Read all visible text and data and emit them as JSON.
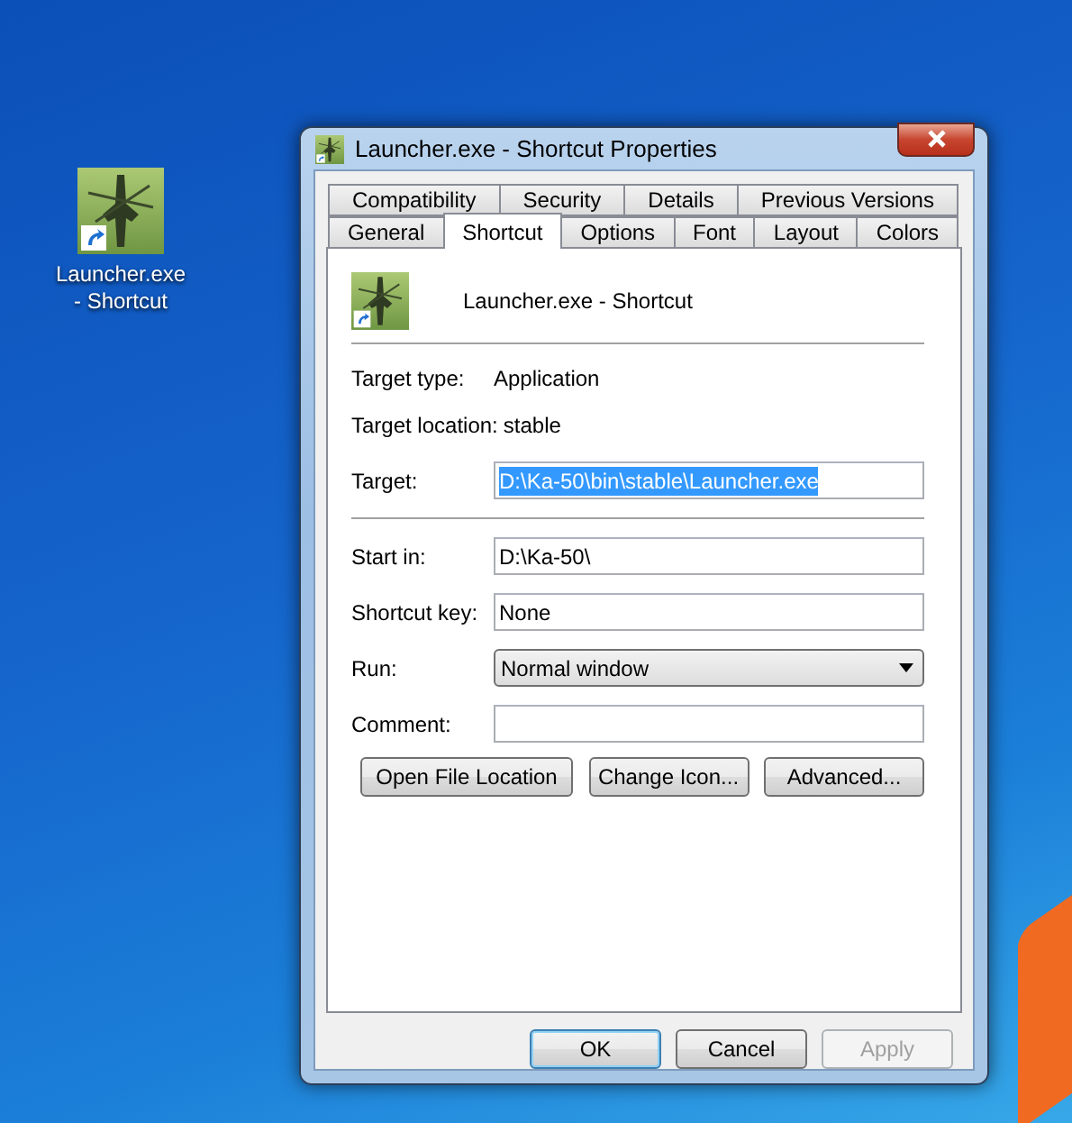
{
  "desktop_icon": {
    "label": "Launcher.exe - Shortcut"
  },
  "window": {
    "title": "Launcher.exe - Shortcut Properties"
  },
  "tab_rows": [
    [
      {
        "label": "Compatibility",
        "selected": false
      },
      {
        "label": "Security",
        "selected": false
      },
      {
        "label": "Details",
        "selected": false
      },
      {
        "label": "Previous Versions",
        "selected": false
      }
    ],
    [
      {
        "label": "General",
        "selected": false
      },
      {
        "label": "Shortcut",
        "selected": true
      },
      {
        "label": "Options",
        "selected": false
      },
      {
        "label": "Font",
        "selected": false
      },
      {
        "label": "Layout",
        "selected": false
      },
      {
        "label": "Colors",
        "selected": false
      }
    ]
  ],
  "header": {
    "name": "Launcher.exe - Shortcut"
  },
  "info": [
    {
      "label": "Target type:",
      "value": "Application"
    },
    {
      "label": "Target location:",
      "value": "stable"
    }
  ],
  "fields": [
    {
      "kind": "text",
      "label": "Target:",
      "value": "D:\\Ka-50\\bin\\stable\\Launcher.exe",
      "text_selected": true
    },
    {
      "kind": "separator"
    },
    {
      "kind": "text",
      "label": "Start in:",
      "value": "D:\\Ka-50\\",
      "text_selected": false
    },
    {
      "kind": "text",
      "label": "Shortcut key:",
      "value": "None",
      "text_selected": false
    },
    {
      "kind": "dropdown",
      "label": "Run:",
      "value": "Normal window"
    },
    {
      "kind": "text",
      "label": "Comment:"
    }
  ],
  "actions": [
    "Open File Location",
    "Change Icon...",
    "Advanced..."
  ],
  "footer_buttons": [
    {
      "label": "OK",
      "default": true,
      "disabled": false
    },
    {
      "label": "Cancel",
      "default": false,
      "disabled": false
    },
    {
      "label": "Apply",
      "default": false,
      "disabled": true
    }
  ]
}
